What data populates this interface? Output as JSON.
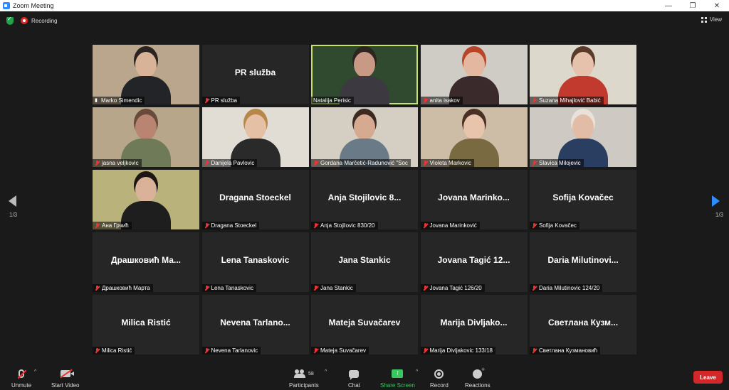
{
  "window": {
    "title": "Zoom Meeting",
    "controls": {
      "minimize": "—",
      "maximize": "❐",
      "close": "✕"
    }
  },
  "topbar": {
    "recording_label": "Recording",
    "view_label": "View"
  },
  "pagination": {
    "left_page": "1/3",
    "right_page": "1/3"
  },
  "participants": [
    {
      "display_name": "Marko Simendic",
      "video": true,
      "muted": false,
      "pinned": true,
      "colors": {
        "bg": "#b9a68c",
        "skin": "#d8b398",
        "hair": "#2b2420",
        "shirt": "#222428"
      }
    },
    {
      "display_name": "PR služba",
      "big_name": "PR služba",
      "video": false,
      "muted": true
    },
    {
      "display_name": "Natalija Perisic",
      "video": true,
      "muted": false,
      "active": true,
      "colors": {
        "bg": "#2f4a2e",
        "skin": "#c89a86",
        "hair": "#2e2420",
        "shirt": "#3c3a40"
      }
    },
    {
      "display_name": "anita isakov",
      "video": true,
      "muted": true,
      "colors": {
        "bg": "#cfcbc5",
        "skin": "#e4b8a0",
        "hair": "#b8452a",
        "shirt": "#3a2a2c"
      }
    },
    {
      "display_name": "Suzana Mihajlović Babić",
      "video": true,
      "muted": true,
      "colors": {
        "bg": "#ddd8cc",
        "skin": "#e6c2ac",
        "hair": "#5a3a28",
        "shirt": "#c23a2e"
      }
    },
    {
      "display_name": "jasna veljkovic",
      "video": true,
      "muted": true,
      "colors": {
        "bg": "#b8a68a",
        "skin": "#b98572",
        "hair": "#6a4a3a",
        "shirt": "#6f7a58"
      }
    },
    {
      "display_name": "Danijela Pavlovic",
      "video": true,
      "muted": true,
      "colors": {
        "bg": "#e2ddd4",
        "skin": "#e6c0a4",
        "hair": "#b7874a",
        "shirt": "#2a2a2a"
      }
    },
    {
      "display_name": "Gordana Marčetić-Radunović \"Soc",
      "video": true,
      "muted": true,
      "colors": {
        "bg": "#d4cfc2",
        "skin": "#d6aa90",
        "hair": "#3a2a22",
        "shirt": "#6a7a86"
      }
    },
    {
      "display_name": "Violeta Markovic",
      "video": true,
      "muted": true,
      "colors": {
        "bg": "#cdbca6",
        "skin": "#e8c4ac",
        "hair": "#4a3024",
        "shirt": "#7a6a42"
      }
    },
    {
      "display_name": "Slavica Milojevic",
      "video": true,
      "muted": true,
      "colors": {
        "bg": "#cec9c2",
        "skin": "#e2bca6",
        "hair": "#e8e2d8",
        "shirt": "#2a3e62"
      }
    },
    {
      "display_name": "Ана Грчић",
      "video": true,
      "muted": true,
      "colors": {
        "bg": "#b9b27a",
        "skin": "#dab29a",
        "hair": "#1c1614",
        "shirt": "#1e1e1e"
      }
    },
    {
      "display_name": "Dragana Stoeckel",
      "big_name": "Dragana Stoeckel",
      "video": false,
      "muted": true
    },
    {
      "display_name": "Anja Stojilovic 830/20",
      "big_name": "Anja Stojilovic 8...",
      "video": false,
      "muted": true
    },
    {
      "display_name": "Jovana Marinković",
      "big_name": "Jovana Marinko...",
      "video": false,
      "muted": true
    },
    {
      "display_name": "Sofija Kovačec",
      "big_name": "Sofija Kovačec",
      "video": false,
      "muted": true
    },
    {
      "display_name": "Драшковић Марта",
      "big_name": "Драшковић Ма...",
      "video": false,
      "muted": true
    },
    {
      "display_name": "Lena Tanaskovic",
      "big_name": "Lena Tanaskovic",
      "video": false,
      "muted": true
    },
    {
      "display_name": "Jana Stankic",
      "big_name": "Jana Stankic",
      "video": false,
      "muted": true
    },
    {
      "display_name": "Jovana Tagić 126/20",
      "big_name": "Jovana Tagić 12...",
      "video": false,
      "muted": true
    },
    {
      "display_name": "Daria Milutinovic 124/20",
      "big_name": "Daria Milutinovi...",
      "video": false,
      "muted": true
    },
    {
      "display_name": "Milica Ristić",
      "big_name": "Milica Ristić",
      "video": false,
      "muted": true
    },
    {
      "display_name": "Nevena Tarlanovic",
      "big_name": "Nevena Tarlano...",
      "video": false,
      "muted": true
    },
    {
      "display_name": "Mateja Suvačarev",
      "big_name": "Mateja Suvačarev",
      "video": false,
      "muted": true
    },
    {
      "display_name": "Marija Divljakovic 133/18",
      "big_name": "Marija Divljako...",
      "video": false,
      "muted": true
    },
    {
      "display_name": "Светлана Кузмановић",
      "big_name": "Светлана Кузм...",
      "video": false,
      "muted": true
    }
  ],
  "toolbar": {
    "unmute": "Unmute",
    "start_video": "Start Video",
    "participants": "Participants",
    "participants_count": "58",
    "chat": "Chat",
    "share_screen": "Share Screen",
    "record": "Record",
    "reactions": "Reactions",
    "leave": "Leave",
    "caret": "^",
    "share_arrow": "↑"
  }
}
